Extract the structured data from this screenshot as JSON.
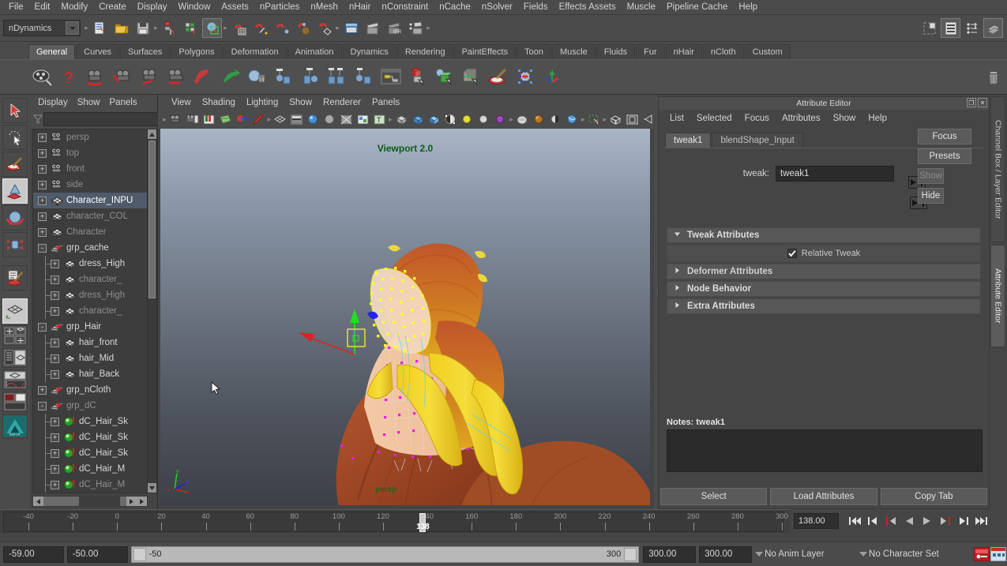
{
  "menubar": {
    "items": [
      "File",
      "Edit",
      "Modify",
      "Create",
      "Display",
      "Window",
      "Assets",
      "nParticles",
      "nMesh",
      "nHair",
      "nConstraint",
      "nCache",
      "nSolver",
      "Fields",
      "Effects Assets",
      "Muscle",
      "Pipeline Cache",
      "Help"
    ]
  },
  "statusbar": {
    "menuset": "nDynamics"
  },
  "shelf": {
    "tabs": [
      "General",
      "Curves",
      "Surfaces",
      "Polygons",
      "Deformation",
      "Animation",
      "Dynamics",
      "Rendering",
      "PaintEffects",
      "Toon",
      "Muscle",
      "Fluids",
      "Fur",
      "nHair",
      "nCloth",
      "Custom"
    ],
    "active_tab": "General"
  },
  "outliner": {
    "menu": [
      "Display",
      "Show",
      "Panels"
    ],
    "filter_value": "",
    "filter_placeholder": "",
    "items": [
      {
        "label": "persp",
        "depth": 0,
        "expander": "+",
        "icon": "camera-icon",
        "style": "dim",
        "selected": false,
        "elbow": false
      },
      {
        "label": "top",
        "depth": 0,
        "expander": "+",
        "icon": "camera-icon",
        "style": "dim",
        "selected": false,
        "elbow": false
      },
      {
        "label": "front",
        "depth": 0,
        "expander": "+",
        "icon": "camera-icon",
        "style": "dim",
        "selected": false,
        "elbow": false
      },
      {
        "label": "side",
        "depth": 0,
        "expander": "+",
        "icon": "camera-icon",
        "style": "dim",
        "selected": false,
        "elbow": false
      },
      {
        "label": "Character_INPU",
        "depth": 0,
        "expander": "+",
        "icon": "mesh-icon",
        "style": "bright",
        "selected": true,
        "elbow": false
      },
      {
        "label": "character_COL",
        "depth": 0,
        "expander": "+",
        "icon": "mesh-icon",
        "style": "dim",
        "selected": false,
        "elbow": false
      },
      {
        "label": "Character",
        "depth": 0,
        "expander": "+",
        "icon": "mesh-icon",
        "style": "dim",
        "selected": false,
        "elbow": false
      },
      {
        "label": "grp_cache",
        "depth": 0,
        "expander": "-",
        "icon": "group-icon",
        "style": "normal",
        "selected": false,
        "elbow": false
      },
      {
        "label": "dress_High",
        "depth": 1,
        "expander": "+",
        "icon": "mesh-icon",
        "style": "normal",
        "selected": false,
        "elbow": true
      },
      {
        "label": "character_",
        "depth": 1,
        "expander": "+",
        "icon": "mesh-icon",
        "style": "dim",
        "selected": false,
        "elbow": true
      },
      {
        "label": "dress_High",
        "depth": 1,
        "expander": "+",
        "icon": "mesh-icon",
        "style": "dim",
        "selected": false,
        "elbow": true
      },
      {
        "label": "character_",
        "depth": 1,
        "expander": "+",
        "icon": "mesh-icon",
        "style": "dim",
        "selected": false,
        "elbow": true
      },
      {
        "label": "grp_Hair",
        "depth": 0,
        "expander": "-",
        "icon": "group-icon",
        "style": "normal",
        "selected": false,
        "elbow": false
      },
      {
        "label": "hair_front",
        "depth": 1,
        "expander": "+",
        "icon": "mesh-icon",
        "style": "normal",
        "selected": false,
        "elbow": true
      },
      {
        "label": "hair_Mid",
        "depth": 1,
        "expander": "+",
        "icon": "mesh-icon",
        "style": "normal",
        "selected": false,
        "elbow": true
      },
      {
        "label": "hair_Back",
        "depth": 1,
        "expander": "+",
        "icon": "mesh-icon",
        "style": "normal",
        "selected": false,
        "elbow": true
      },
      {
        "label": "grp_nCloth",
        "depth": 0,
        "expander": "+",
        "icon": "group-icon",
        "style": "normal",
        "selected": false,
        "elbow": false
      },
      {
        "label": "grp_dC",
        "depth": 0,
        "expander": "-",
        "icon": "group-icon",
        "style": "dim",
        "selected": false,
        "elbow": false
      },
      {
        "label": "dC_Hair_Sk",
        "depth": 1,
        "expander": "+",
        "icon": "ncloth-icon",
        "style": "normal",
        "selected": false,
        "elbow": true
      },
      {
        "label": "dC_Hair_Sk",
        "depth": 1,
        "expander": "+",
        "icon": "ncloth-icon",
        "style": "normal",
        "selected": false,
        "elbow": true
      },
      {
        "label": "dC_Hair_Sk",
        "depth": 1,
        "expander": "+",
        "icon": "ncloth-icon",
        "style": "normal",
        "selected": false,
        "elbow": true
      },
      {
        "label": "dC_Hair_M",
        "depth": 1,
        "expander": "+",
        "icon": "ncloth-icon",
        "style": "normal",
        "selected": false,
        "elbow": true
      },
      {
        "label": "dC_Hair_M",
        "depth": 1,
        "expander": "+",
        "icon": "ncloth-icon",
        "style": "dim",
        "selected": false,
        "elbow": true
      }
    ]
  },
  "viewport": {
    "menu": [
      "View",
      "Shading",
      "Lighting",
      "Show",
      "Renderer",
      "Panels"
    ],
    "overlay_label": "Viewport 2.0",
    "camera_label": "persp",
    "axis": {
      "x": "x",
      "y": "y",
      "z": "z"
    }
  },
  "attribute_editor": {
    "title": "Attribute Editor",
    "menu": [
      "List",
      "Selected",
      "Focus",
      "Attributes",
      "Show",
      "Help"
    ],
    "tabs": [
      "tweak1",
      "blendShape_Input"
    ],
    "active_tab": "tweak1",
    "field_label": "tweak:",
    "field_value": "tweak1",
    "buttons": {
      "focus": "Focus",
      "presets": "Presets",
      "show": "Show",
      "hide": "Hide"
    },
    "sections": [
      {
        "title": "Tweak Attributes",
        "expanded": true
      },
      {
        "title": "Deformer Attributes",
        "expanded": false
      },
      {
        "title": "Node Behavior",
        "expanded": false
      },
      {
        "title": "Extra Attributes",
        "expanded": false
      }
    ],
    "relative_tweak_label": "Relative Tweak",
    "relative_tweak_checked": true,
    "notes_label": "Notes: tweak1",
    "notes_value": "",
    "footer": [
      "Select",
      "Load Attributes",
      "Copy Tab"
    ]
  },
  "right_tabs": {
    "items": [
      "Channel Box / Layer Editor",
      "Attribute Editor"
    ],
    "active": "Attribute Editor"
  },
  "timeline": {
    "ticks": [
      -40,
      -20,
      0,
      20,
      40,
      60,
      80,
      100,
      120,
      140,
      160,
      180,
      200,
      220,
      240,
      260,
      280,
      300
    ],
    "range_start": -50,
    "range_end": 300,
    "current_frame": 138,
    "current_frame_label": "138",
    "current_time_field": "138.00"
  },
  "range_slider": {
    "anim_start": "-59.00",
    "range_start": "-50.00",
    "range_start_label": "-50",
    "range_end_label": "300",
    "range_end": "300.00",
    "anim_end": "300.00",
    "anim_layer": "No Anim Layer",
    "character_set": "No Character Set"
  },
  "colors": {
    "ui_bg": "#454545",
    "panel_bg": "#4b4b4b",
    "selection_blue": "#4f5b6b",
    "accent_green": "#0d5c18",
    "field_bg": "#2b2b2b"
  }
}
